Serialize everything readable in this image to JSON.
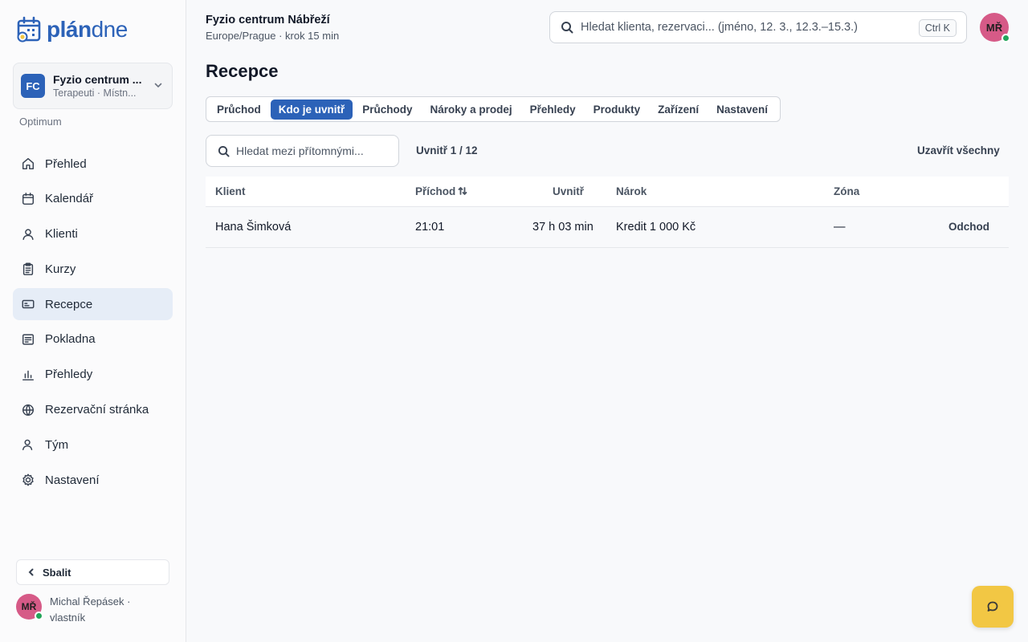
{
  "brand": {
    "name_bold": "plán",
    "name_light": "dne",
    "accent": "#2c62b8"
  },
  "sidebar": {
    "org": {
      "initials": "FC",
      "name": "Fyzio centrum ...",
      "sub": "Terapeuti · Místn..."
    },
    "plan": "Optimum",
    "items": [
      {
        "label": "Přehled",
        "icon": "home-icon",
        "active": false
      },
      {
        "label": "Kalendář",
        "icon": "calendar-icon",
        "active": false
      },
      {
        "label": "Klienti",
        "icon": "user-icon",
        "active": false
      },
      {
        "label": "Kurzy",
        "icon": "clipboard-icon",
        "active": false
      },
      {
        "label": "Recepce",
        "icon": "id-card-icon",
        "active": true
      },
      {
        "label": "Pokladna",
        "icon": "receipt-icon",
        "active": false
      },
      {
        "label": "Přehledy",
        "icon": "bar-chart-icon",
        "active": false
      },
      {
        "label": "Rezervační stránka",
        "icon": "globe-icon",
        "active": false
      },
      {
        "label": "Tým",
        "icon": "team-icon",
        "active": false
      },
      {
        "label": "Nastavení",
        "icon": "gear-icon",
        "active": false
      }
    ],
    "collapse_label": "Sbalit",
    "user": {
      "initials": "MŘ",
      "name": "Michal Řepásek · vlastník"
    }
  },
  "header": {
    "title": "Fyzio centrum Nábřeží",
    "subtitle": "Europe/Prague · krok 15 min",
    "search_placeholder": "Hledat klienta, rezervaci... (jméno, 12. 3., 12.3.–15.3.)",
    "shortcut": "Ctrl K",
    "avatar_initials": "MŘ"
  },
  "page": {
    "title": "Recepce",
    "tabs": [
      {
        "label": "Průchod",
        "active": false
      },
      {
        "label": "Kdo je uvnitř",
        "active": true
      },
      {
        "label": "Průchody",
        "active": false
      },
      {
        "label": "Nároky a prodej",
        "active": false
      },
      {
        "label": "Přehledy",
        "active": false
      },
      {
        "label": "Produkty",
        "active": false
      },
      {
        "label": "Zařízení",
        "active": false
      },
      {
        "label": "Nastavení",
        "active": false
      }
    ],
    "filter_placeholder": "Hledat mezi přítomnými...",
    "inside_count": "Uvnitř 1 / 12",
    "close_all": "Uzavřít všechny"
  },
  "table": {
    "columns": [
      "Klient",
      "Příchod",
      "Uvnitř",
      "Nárok",
      "Zóna"
    ],
    "rows": [
      {
        "client": "Hana Šimková",
        "arrival": "21:01",
        "inside": "37 h 03 min",
        "entitlement": "Kredit 1 000 Kč",
        "zone": "—",
        "action": "Odchod"
      }
    ]
  },
  "colors": {
    "active_tab": "#2c62b8",
    "active_nav": "#e6edf7",
    "online": "#22a559",
    "avatar": "#d65a87",
    "chat_button": "#f2c744"
  }
}
